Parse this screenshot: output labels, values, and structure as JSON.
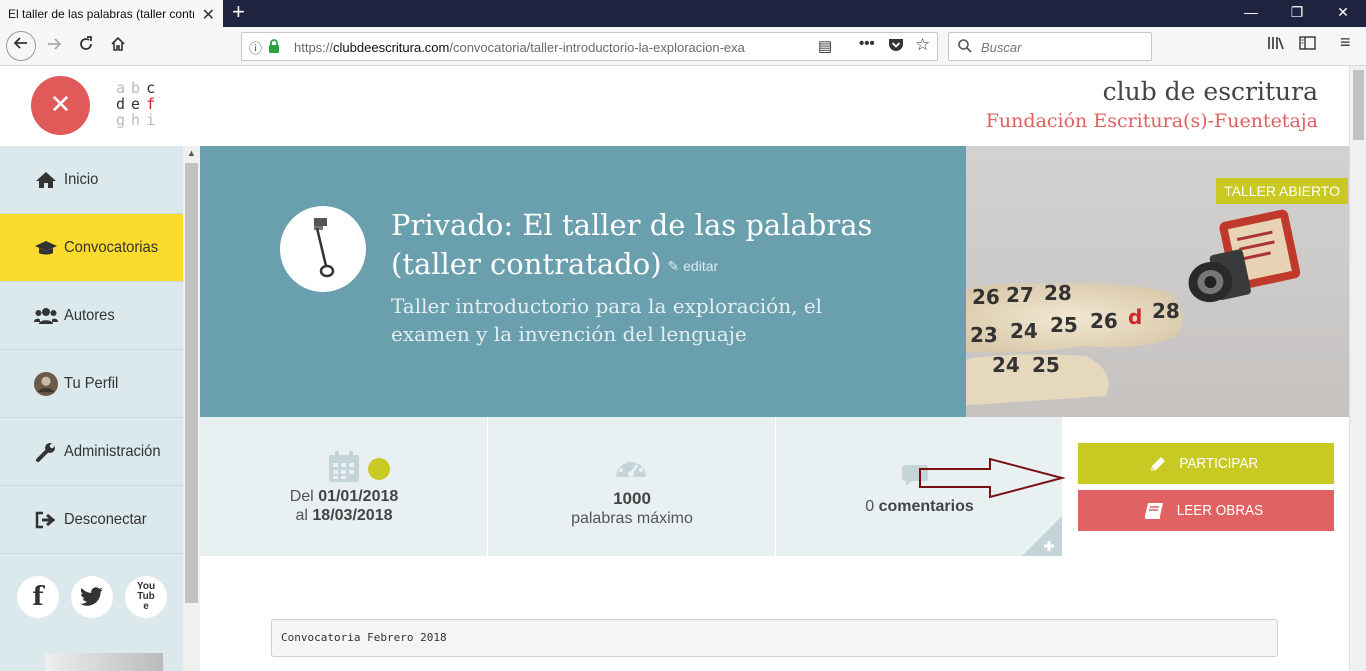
{
  "browser": {
    "tab_title": "El taller de las palabras (taller contra",
    "url_prefix": "https://",
    "url_domain": "clubdeescritura.com",
    "url_path": "/convocatoria/taller-introductorio-la-exploracion-exa",
    "search_placeholder": "Buscar"
  },
  "header": {
    "close_symbol": "✕",
    "logo_rows": [
      [
        "a",
        "b",
        "c"
      ],
      [
        "d",
        "e",
        "f"
      ],
      [
        "g",
        "h",
        "i"
      ]
    ],
    "brand_title": "club de escritura",
    "brand_subtitle": "Fundación Escritura(s)-Fuentetaja"
  },
  "sidebar": {
    "items": [
      {
        "label": "Inicio",
        "icon": "home-icon"
      },
      {
        "label": "Convocatorias",
        "icon": "graduation-cap-icon",
        "active": true
      },
      {
        "label": "Autores",
        "icon": "users-icon"
      },
      {
        "label": "Tu Perfil",
        "icon": "avatar-icon"
      },
      {
        "label": "Administración",
        "icon": "wrench-icon"
      },
      {
        "label": "Desconectar",
        "icon": "sign-out-icon"
      }
    ],
    "social": [
      {
        "label": "f",
        "icon": "facebook-icon"
      },
      {
        "label": "",
        "icon": "twitter-icon"
      },
      {
        "label": "YouTube",
        "icon": "youtube-icon"
      }
    ]
  },
  "hero": {
    "title": "Privado: El taller de las palabras (taller contratado)",
    "edit_label": "editar",
    "subtitle": "Taller introductorio para la exploración, el examen y la invención del lenguaje",
    "badge": "TALLER ABIERTO",
    "image_numbers": [
      "26",
      "27",
      "28",
      "23",
      "24",
      "25",
      "26",
      "d",
      "28",
      "24",
      "25"
    ]
  },
  "info": {
    "date_prefix": "Del",
    "date_start": "01/01/2018",
    "date_mid": "al",
    "date_end": "18/03/2018",
    "words_count": "1000",
    "words_label": "palabras máximo",
    "comments_count": "0",
    "comments_label": "comentarios"
  },
  "actions": {
    "participar_label": "PARTICIPAR",
    "leer_label": "LEER OBRAS"
  },
  "content": {
    "code_text": "Convocatoria Febrero 2018"
  },
  "colors": {
    "accent_yellow": "#fbdc2c",
    "hero_blue": "#6a9fad",
    "olive": "#c8c923",
    "red": "#e06262",
    "arrow": "#7a1010"
  }
}
